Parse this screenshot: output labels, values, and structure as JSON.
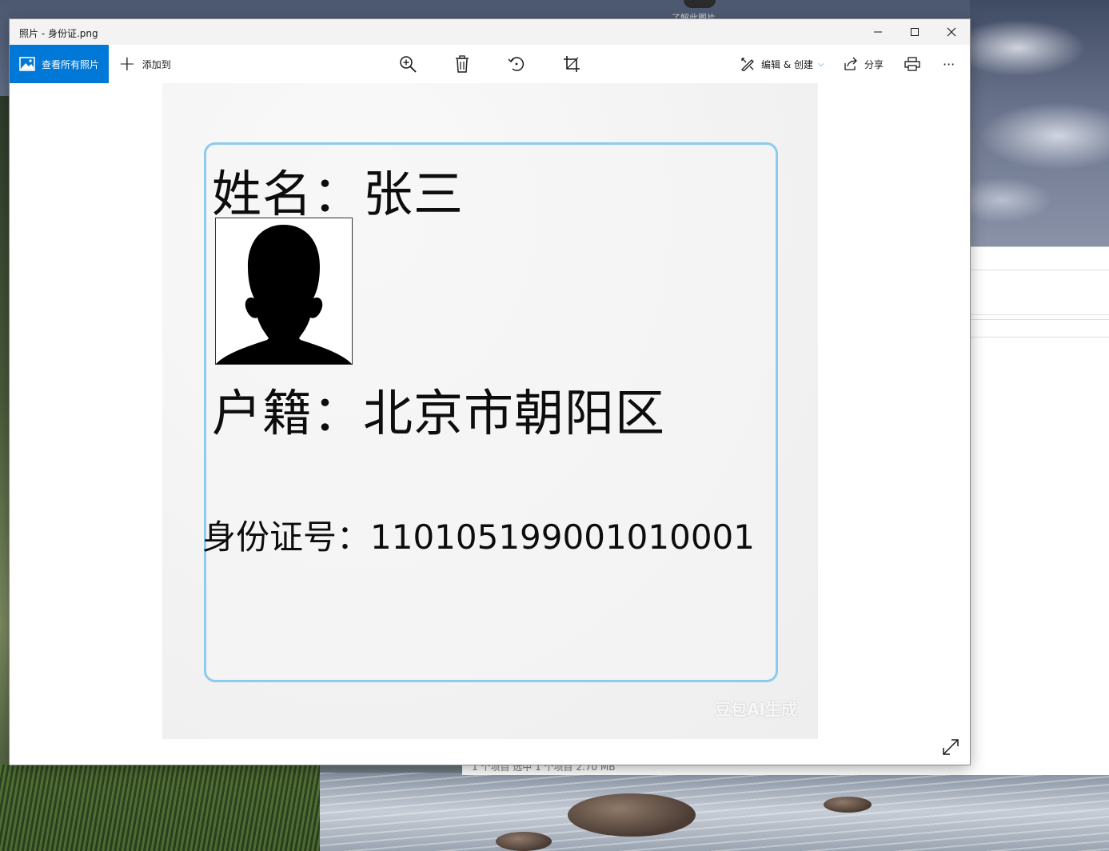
{
  "window": {
    "title": "照片 - 身份证.png",
    "minimize_glyph": "—",
    "maximize_glyph": "☐",
    "close_glyph": "✕"
  },
  "toolbar": {
    "view_all_label": "查看所有照片",
    "add_to_label": "添加到",
    "edit_create_label": "编辑 & 创建",
    "share_label": "分享",
    "more_glyph": "···",
    "icons": [
      "zoom-in-icon",
      "delete-icon",
      "rotate-icon",
      "crop-icon",
      "print-icon"
    ],
    "accent_color": "#0078d7"
  },
  "photo": {
    "name_line": "姓名：张三",
    "address_line": "户籍：北京市朝阳区",
    "id_line": "身份证号：110105199001010001",
    "watermark": "豆包AI生成",
    "border_color": "#8ccbee"
  },
  "background": {
    "tray_text": "了解此图片",
    "explorer_status": "1 个项目    选中 1 个项目  2.70 MB"
  }
}
